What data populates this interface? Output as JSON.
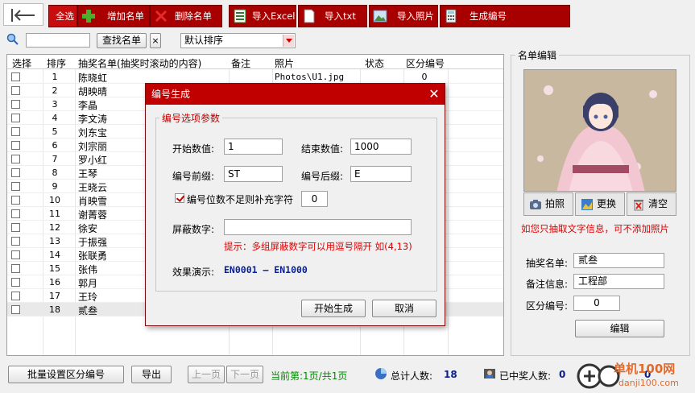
{
  "toolbar": {
    "select_all": "全选",
    "add_list": "增加名单",
    "delete_list": "删除名单",
    "import_excel": "导入Excel",
    "import_txt": "导入txt",
    "import_photo": "导入照片",
    "generate_number": "生成编号"
  },
  "search": {
    "find_button": "查找名单",
    "clear_button": "×",
    "sort_value": "默认排序"
  },
  "grid": {
    "headers": [
      "选择",
      "排序",
      "抽奖名单(抽奖时滚动的内容)",
      "备注",
      "照片",
      "状态",
      "区分编号"
    ],
    "rows": [
      {
        "order": "1",
        "name": "陈晓虹",
        "photo": "Photos\\U1.jpg",
        "region": "0"
      },
      {
        "order": "2",
        "name": "胡映晴",
        "photo": "",
        "region": ""
      },
      {
        "order": "3",
        "name": "李晶",
        "photo": "",
        "region": ""
      },
      {
        "order": "4",
        "name": "李文涛",
        "photo": "",
        "region": ""
      },
      {
        "order": "5",
        "name": "刘东宝",
        "photo": "",
        "region": ""
      },
      {
        "order": "6",
        "name": "刘宗丽",
        "photo": "",
        "region": ""
      },
      {
        "order": "7",
        "name": "罗小红",
        "photo": "",
        "region": ""
      },
      {
        "order": "8",
        "name": "王琴",
        "photo": "",
        "region": ""
      },
      {
        "order": "9",
        "name": "王晓云",
        "photo": "",
        "region": ""
      },
      {
        "order": "10",
        "name": "肖映雪",
        "photo": "",
        "region": ""
      },
      {
        "order": "11",
        "name": "谢菁蓉",
        "photo": "",
        "region": ""
      },
      {
        "order": "12",
        "name": "徐安",
        "photo": "",
        "region": ""
      },
      {
        "order": "13",
        "name": "于振强",
        "photo": "",
        "region": ""
      },
      {
        "order": "14",
        "name": "张联勇",
        "photo": "",
        "region": ""
      },
      {
        "order": "15",
        "name": "张伟",
        "photo": "",
        "region": ""
      },
      {
        "order": "16",
        "name": "郭月",
        "photo": "",
        "region": ""
      },
      {
        "order": "17",
        "name": "王玲",
        "photo": "",
        "region": ""
      },
      {
        "order": "18",
        "name": "贰叁",
        "photo": "",
        "region": ""
      }
    ]
  },
  "panel": {
    "title": "名单编辑",
    "take_photo": "拍照",
    "replace": "更换",
    "clear": "清空",
    "warning": "如您只抽取文字信息，可不添加照片",
    "lottery_name_label": "抽奖名单:",
    "lottery_name_value": "贰叁",
    "remark_label": "备注信息:",
    "remark_value": "工程部",
    "region_label": "区分编号:",
    "region_value": "0",
    "edit_button": "编辑"
  },
  "bottom": {
    "batch_button": "批量设置区分编号",
    "export_button": "导出",
    "prev_button": "上一页",
    "next_button": "下一页",
    "page_info": "当前第:1页/共1页",
    "total_label": "总计人数:",
    "total_value": "18",
    "winners_label": "已中奖人数:",
    "winners_value": "0",
    "other_value": "0"
  },
  "dialog": {
    "title": "编号生成",
    "close": "✕",
    "group_title": "编号选项参数",
    "start_label": "开始数值:",
    "start_value": "1",
    "end_label": "结束数值:",
    "end_value": "1000",
    "prefix_label": "编号前缀:",
    "prefix_value": "ST",
    "suffix_label": "编号后缀:",
    "suffix_value": "E",
    "pad_label": "编号位数不足则补充字符",
    "pad_value": "0",
    "mask_label": "屏蔽数字:",
    "mask_value": "",
    "hint": "提示：多组屏蔽数字可以用逗号隔开 如(4,13)",
    "demo_label": "效果演示:",
    "demo_value": "EN0001 — EN1000",
    "generate_button": "开始生成",
    "cancel_button": "取消"
  },
  "watermark": {
    "site_cn": "单机100网",
    "site_url": "danji100.com"
  }
}
